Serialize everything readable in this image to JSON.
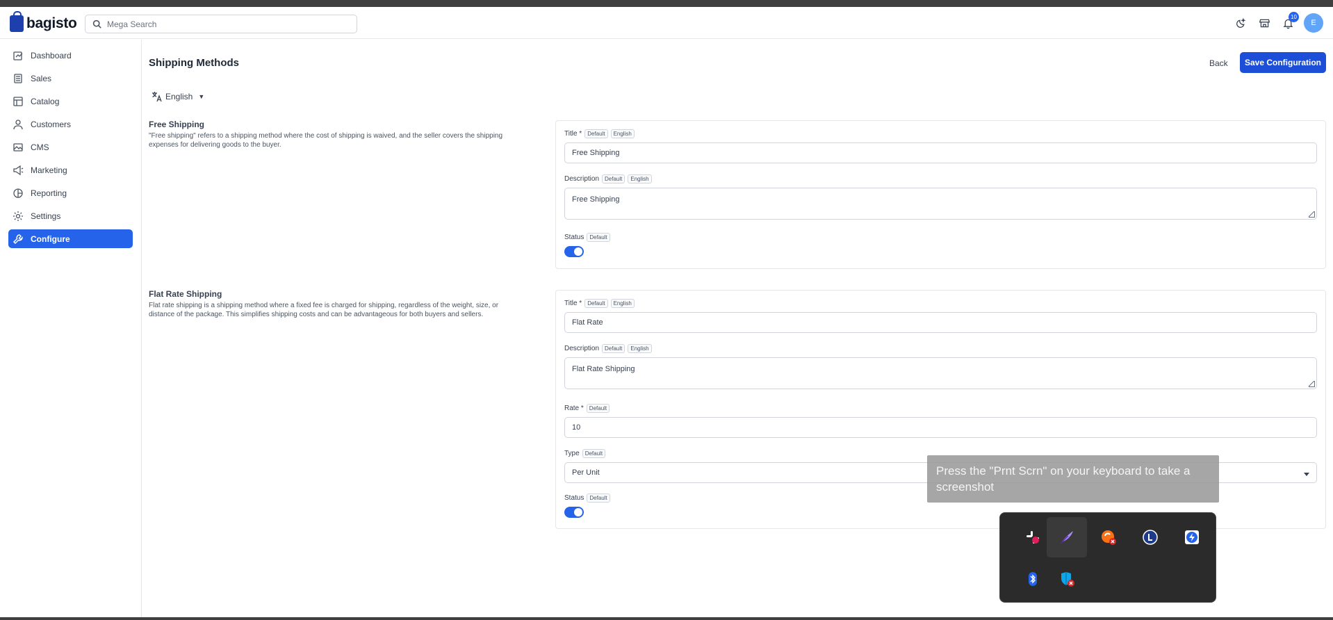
{
  "app": {
    "brand": "bagisto"
  },
  "search": {
    "placeholder": "Mega Search"
  },
  "header": {
    "notification_count": "10",
    "avatar_initial": "E"
  },
  "sidebar": {
    "items": [
      {
        "label": "Dashboard",
        "icon": "dashboard-icon"
      },
      {
        "label": "Sales",
        "icon": "sales-icon"
      },
      {
        "label": "Catalog",
        "icon": "catalog-icon"
      },
      {
        "label": "Customers",
        "icon": "customers-icon"
      },
      {
        "label": "CMS",
        "icon": "cms-icon"
      },
      {
        "label": "Marketing",
        "icon": "marketing-icon"
      },
      {
        "label": "Reporting",
        "icon": "reporting-icon"
      },
      {
        "label": "Settings",
        "icon": "settings-icon"
      },
      {
        "label": "Configure",
        "icon": "configure-icon",
        "active": true
      }
    ]
  },
  "page": {
    "title": "Shipping Methods",
    "back_label": "Back",
    "save_label": "Save Configuration",
    "locale": "English"
  },
  "free_shipping": {
    "heading": "Free Shipping",
    "description": "\"Free shipping\" refers to a shipping method where the cost of shipping is waived, and the seller covers the shipping expenses for delivering goods to the buyer.",
    "title_label": "Title *",
    "title_value": "Free Shipping",
    "description_label": "Description",
    "description_value": "Free Shipping",
    "status_label": "Status",
    "status_on": true
  },
  "flat_rate": {
    "heading": "Flat Rate Shipping",
    "description": "Flat rate shipping is a shipping method where a fixed fee is charged for shipping, regardless of the weight, size, or distance of the package. This simplifies shipping costs and can be advantageous for both buyers and sellers.",
    "title_label": "Title *",
    "title_value": "Flat Rate",
    "description_label": "Description",
    "description_value": "Flat Rate Shipping",
    "rate_label": "Rate *",
    "rate_value": "10",
    "type_label": "Type",
    "type_value": "Per Unit",
    "status_label": "Status",
    "status_on": true
  },
  "tags": {
    "default": "Default",
    "english": "English"
  },
  "overlay": {
    "tip": "Press the \"Prnt Scrn\" on your keyboard to take a screenshot"
  },
  "tray": {
    "icons": [
      "slack-icon",
      "feather-pen-icon",
      "sync-error-icon",
      "l-circle-icon",
      "lightning-icon",
      "bluetooth-icon",
      "shield-error-icon"
    ]
  },
  "colors": {
    "accent": "#2563eb",
    "brand": "#1e40af"
  }
}
